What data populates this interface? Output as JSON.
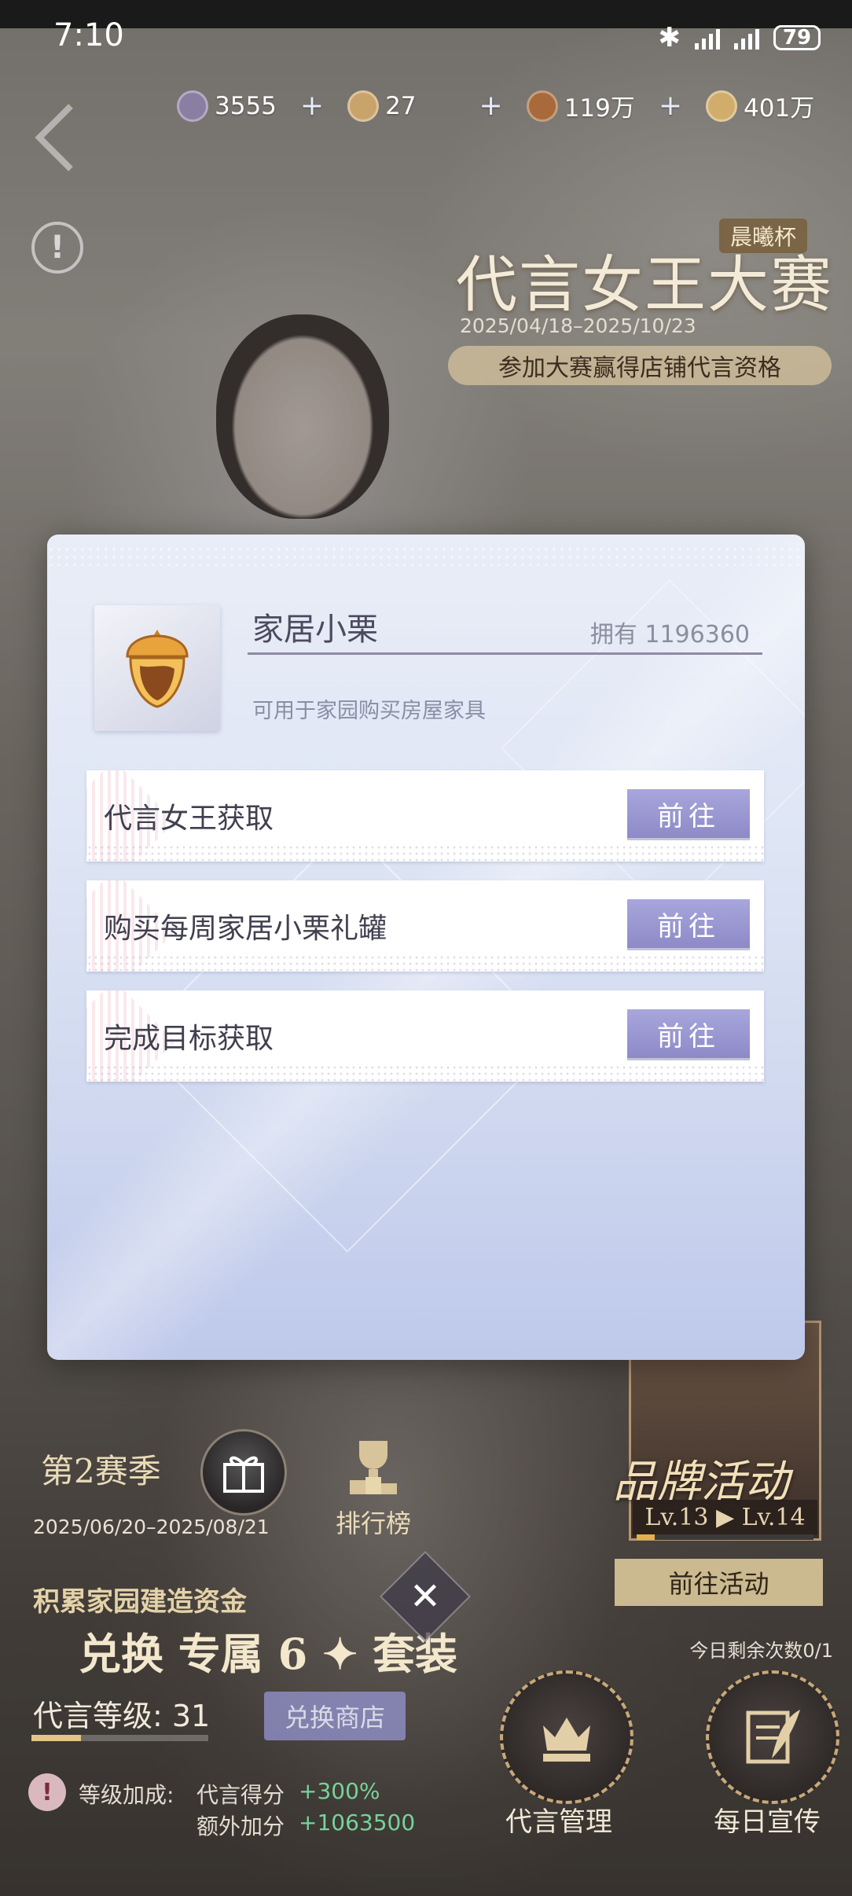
{
  "status_bar": {
    "time": "7:10",
    "battery": "79"
  },
  "currencies": [
    {
      "icon": "diamond-coin-icon",
      "value": "3555",
      "color": "#8a7fa3"
    },
    {
      "icon": "crown-coin-icon",
      "value": "27",
      "color": "#c9a46a"
    },
    {
      "icon": "acorn-coin-icon",
      "value": "119万",
      "color": "#a86a3a"
    },
    {
      "icon": "gold-coin-icon",
      "value": "401万",
      "color": "#d1ad6c"
    }
  ],
  "add_label": "+",
  "event": {
    "title": "代言女王大赛",
    "tag": "晨曦杯",
    "dates": "2025/04/18–2025/10/23",
    "pill": "参加大赛赢得店铺代言资格"
  },
  "modal": {
    "item_name": "家居小栗",
    "owned": "拥有 1196360",
    "description": "可用于家园购买房屋家具",
    "sources": [
      {
        "label": "代言女王获取",
        "button": "前往"
      },
      {
        "label": "购买每周家居小栗礼罐",
        "button": "前往"
      },
      {
        "label": "完成目标获取",
        "button": "前往"
      }
    ]
  },
  "hud": {
    "season": "第2赛季",
    "season_dates": "2025/06/20–2025/08/21",
    "rank_label": "排行榜",
    "fund_line1": "积累家园建造资金",
    "fund_line2": "兑换 专属 6 ✦ 套装",
    "level_label": "代言等级: 31",
    "level_progress": 0.28,
    "shop_button": "兑换商店",
    "bonus_label": "等级加成:",
    "bonus_name1": "代言得分",
    "bonus_value1": "+300%",
    "bonus_name2": "额外加分",
    "bonus_value2": "+1063500",
    "brand_title": "品牌活动",
    "brand_level": "Lv.13 ▶ Lv.14",
    "brand_progress": 0.1,
    "goto_activity": "前往活动",
    "remaining": "今日剩余次数0/1",
    "manage_label": "代言管理",
    "daily_label": "每日宣传",
    "close_symbol": "✕"
  }
}
